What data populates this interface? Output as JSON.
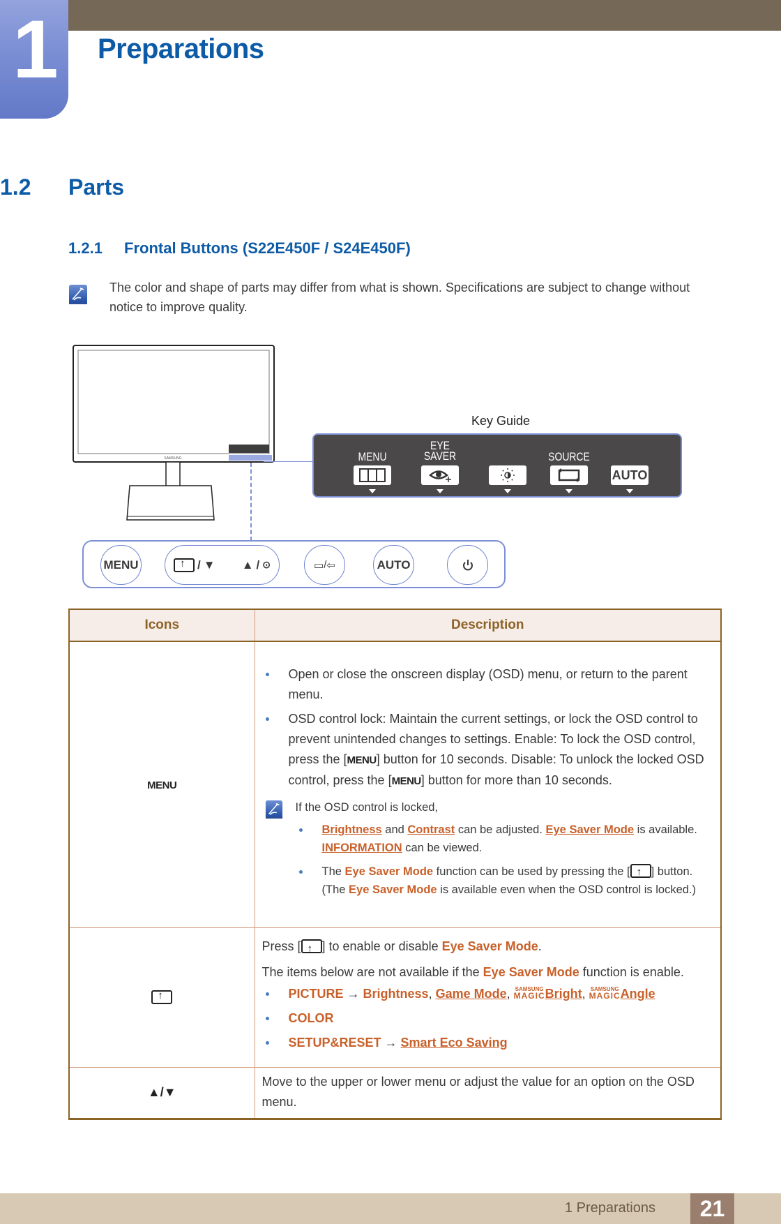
{
  "chapter": {
    "number": "1",
    "title": "Preparations"
  },
  "section": {
    "number": "1.2",
    "title": "Parts"
  },
  "subsection": {
    "number": "1.2.1",
    "title": "Frontal Buttons (S22E450F / S24E450F)"
  },
  "note_top": "The color and shape of parts may differ from what is shown. Specifications are subject to change without notice to improve quality.",
  "diagram": {
    "monitor_brand": "SAMSUNG",
    "key_guide_label": "Key Guide",
    "key_guide_items": [
      {
        "label": "MENU",
        "icon": "menu-grid-icon"
      },
      {
        "label_top": "EYE",
        "label": "SAVER",
        "icon": "eye-saver-icon"
      },
      {
        "label": "",
        "icon": "brightness-icon"
      },
      {
        "label": "SOURCE",
        "icon": "source-icon"
      },
      {
        "label": "",
        "button_text": "AUTO",
        "icon": "auto-icon"
      }
    ],
    "buttons": [
      {
        "label": "MENU"
      },
      {
        "label": "/",
        "icon_left": "eye-saver-icon",
        "icon_right": "down-triangle-icon"
      },
      {
        "label": "/",
        "icon_left": "up-triangle-icon",
        "icon_right": "enter-icon"
      },
      {
        "label": "/",
        "icon_left": "source-icon",
        "icon_right": "input-icon"
      },
      {
        "label": "AUTO"
      },
      {
        "label": "",
        "icon": "power-icon"
      }
    ]
  },
  "table": {
    "headers": [
      "Icons",
      "Description"
    ],
    "rows": [
      {
        "icon_text": "MENU",
        "bullets": [
          "Open or close the onscreen display (OSD) menu, or return to the parent menu.",
          {
            "a": "OSD control lock: Maintain the current settings, or lock the OSD control to prevent unintended changes to settings. Enable: To lock the OSD control, press the [",
            "key1": "MENU",
            "b": "] button for 10 seconds. Disable: To unlock the locked OSD control, press the [",
            "key2": "MENU",
            "c": "] button for more than 10 seconds."
          }
        ],
        "note": {
          "intro": "If the OSD control is locked,",
          "b1": {
            "l1": "Brightness",
            "t1": " and ",
            "l2": "Contrast",
            "t2": " can be adjusted. ",
            "l3": "Eye Saver Mode",
            "t3": " is available. ",
            "l4": "INFORMATION",
            "t4": " can be viewed."
          },
          "b2": {
            "t1": "The ",
            "o1": "Eye Saver Mode",
            "t2": " function can be used by pressing the [",
            "t3": "] button. (The ",
            "o2": "Eye Saver Mode",
            "t4": " is available even when the OSD control is locked.)"
          }
        }
      },
      {
        "icon": "eye-saver-icon",
        "p1": {
          "a": "Press [",
          "b": "] to enable or disable ",
          "o": "Eye Saver Mode",
          "c": "."
        },
        "p2": {
          "a": "The items below are not available if the ",
          "o": "Eye Saver Mode",
          "b": " function is enable."
        },
        "items": [
          {
            "o1": "PICTURE",
            "arrow": " → ",
            "o2": "Brightness",
            "sep1": ", ",
            "l1": "Game Mode",
            "sep2": ", ",
            "magic1_top": "SAMSUNG",
            "magic1_bottom": "MAGIC",
            "l2": "Bright",
            "sep3": ", ",
            "magic2_top": "SAMSUNG",
            "magic2_bottom": "MAGIC",
            "l3": "Angle"
          },
          {
            "o1": "COLOR"
          },
          {
            "o1": "SETUP&RESET",
            "arrow": " → ",
            "l1": "Smart Eco Saving"
          }
        ]
      },
      {
        "icon_text": "▲/▼",
        "desc": "Move to the upper or lower menu or adjust the value for an option on the OSD menu."
      }
    ]
  },
  "footer": {
    "label": "1 Preparations",
    "page": "21"
  },
  "colors": {
    "heading_blue": "#0d5ba6",
    "accent_orange": "#c8602a",
    "table_brown": "#8c6327",
    "top_bar": "#766856",
    "footer_bar": "#d8c9b4"
  }
}
